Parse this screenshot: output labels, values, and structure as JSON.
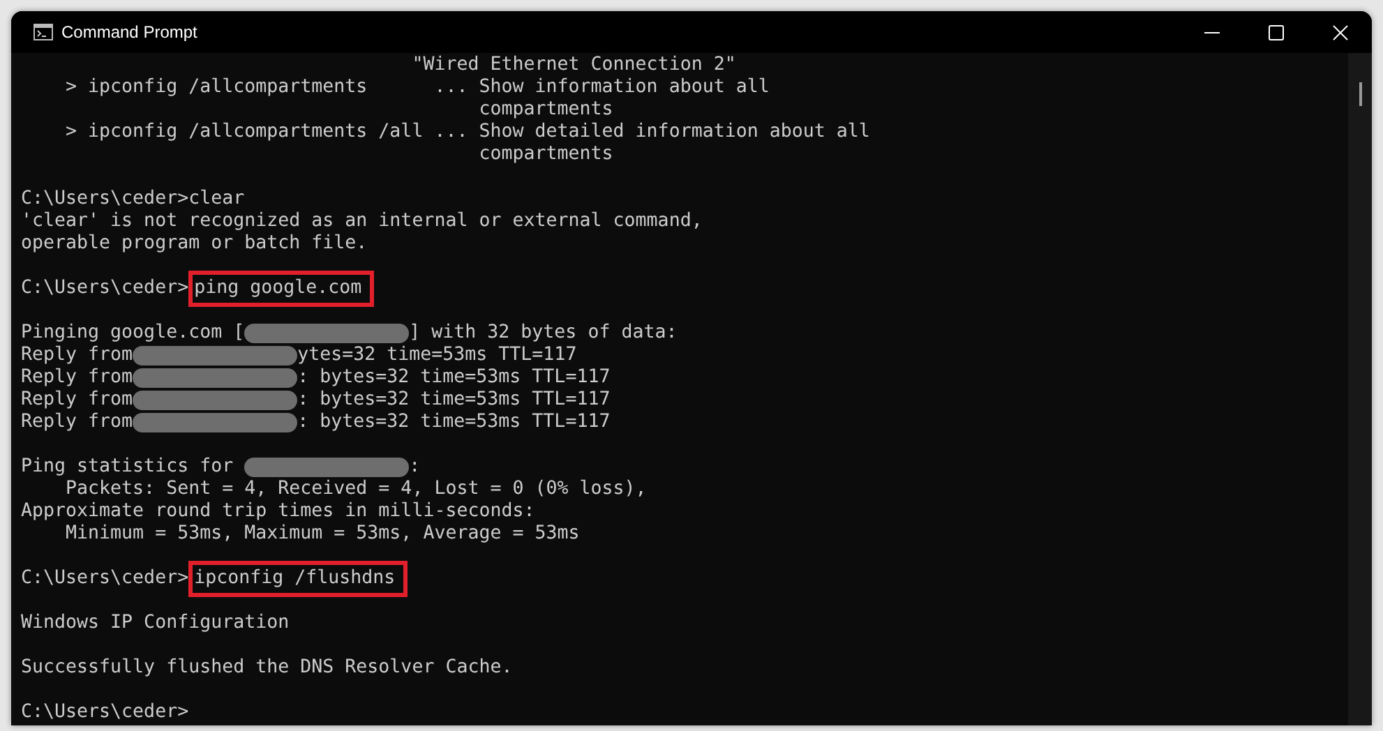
{
  "window": {
    "title": "Command Prompt",
    "controls": [
      {
        "kind": "minimize"
      },
      {
        "kind": "maximize"
      },
      {
        "kind": "close"
      }
    ]
  },
  "console": {
    "blocks": [
      {
        "lines": [
          {
            "segments": [
              {
                "kind": "text",
                "text": "                                   \"Wired Ethernet Connection 2\""
              }
            ]
          },
          {
            "segments": [
              {
                "kind": "text",
                "text": "    > ipconfig /allcompartments      ... Show information about all"
              }
            ]
          },
          {
            "segments": [
              {
                "kind": "text",
                "text": "                                         compartments"
              }
            ]
          },
          {
            "segments": [
              {
                "kind": "text",
                "text": "    > ipconfig /allcompartments /all ... Show detailed information about all"
              }
            ]
          },
          {
            "segments": [
              {
                "kind": "text",
                "text": "                                         compartments"
              }
            ]
          }
        ]
      },
      {
        "lines": [
          {
            "segments": [
              {
                "kind": "text",
                "text": "C:\\Users\\ceder>clear"
              }
            ]
          },
          {
            "segments": [
              {
                "kind": "text",
                "text": "'clear' is not recognized as an internal or external command,"
              }
            ]
          },
          {
            "segments": [
              {
                "kind": "text",
                "text": "operable program or batch file."
              }
            ]
          }
        ]
      },
      {
        "lines": [
          {
            "segments": [
              {
                "kind": "text",
                "text": "C:\\Users\\ceder>"
              },
              {
                "kind": "highlighted",
                "text": "ping google.com"
              }
            ]
          }
        ]
      },
      {
        "lines": [
          {
            "segments": [
              {
                "kind": "text",
                "text": "Pinging google.com ["
              },
              {
                "kind": "redacted"
              },
              {
                "kind": "text",
                "text": "] with 32 bytes of data:"
              }
            ]
          },
          {
            "segments": [
              {
                "kind": "text",
                "text": "Reply from"
              },
              {
                "kind": "redacted"
              },
              {
                "kind": "text",
                "text": "ytes=32 time=53ms TTL=117"
              }
            ]
          },
          {
            "segments": [
              {
                "kind": "text",
                "text": "Reply from"
              },
              {
                "kind": "redacted"
              },
              {
                "kind": "text",
                "text": ": bytes=32 time=53ms TTL=117"
              }
            ]
          },
          {
            "segments": [
              {
                "kind": "text",
                "text": "Reply from"
              },
              {
                "kind": "redacted"
              },
              {
                "kind": "text",
                "text": ": bytes=32 time=53ms TTL=117"
              }
            ]
          },
          {
            "segments": [
              {
                "kind": "text",
                "text": "Reply from"
              },
              {
                "kind": "redacted"
              },
              {
                "kind": "text",
                "text": ": bytes=32 time=53ms TTL=117"
              }
            ]
          }
        ]
      },
      {
        "lines": [
          {
            "segments": [
              {
                "kind": "text",
                "text": "Ping statistics for "
              },
              {
                "kind": "redacted"
              },
              {
                "kind": "text",
                "text": ":"
              }
            ]
          },
          {
            "segments": [
              {
                "kind": "text",
                "text": "    Packets: Sent = 4, Received = 4, Lost = 0 (0% loss),"
              }
            ]
          },
          {
            "segments": [
              {
                "kind": "text",
                "text": "Approximate round trip times in milli-seconds:"
              }
            ]
          },
          {
            "segments": [
              {
                "kind": "text",
                "text": "    Minimum = 53ms, Maximum = 53ms, Average = 53ms"
              }
            ]
          }
        ]
      },
      {
        "lines": [
          {
            "segments": [
              {
                "kind": "text",
                "text": "C:\\Users\\ceder>"
              },
              {
                "kind": "highlighted",
                "text": "ipconfig /flushdns"
              }
            ]
          }
        ]
      },
      {
        "lines": [
          {
            "segments": [
              {
                "kind": "text",
                "text": "Windows IP Configuration"
              }
            ]
          }
        ]
      },
      {
        "lines": [
          {
            "segments": [
              {
                "kind": "text",
                "text": "Successfully flushed the DNS Resolver Cache."
              }
            ]
          }
        ]
      },
      {
        "lines": [
          {
            "segments": [
              {
                "kind": "text",
                "text": "C:\\Users\\ceder>"
              }
            ]
          }
        ]
      }
    ]
  }
}
